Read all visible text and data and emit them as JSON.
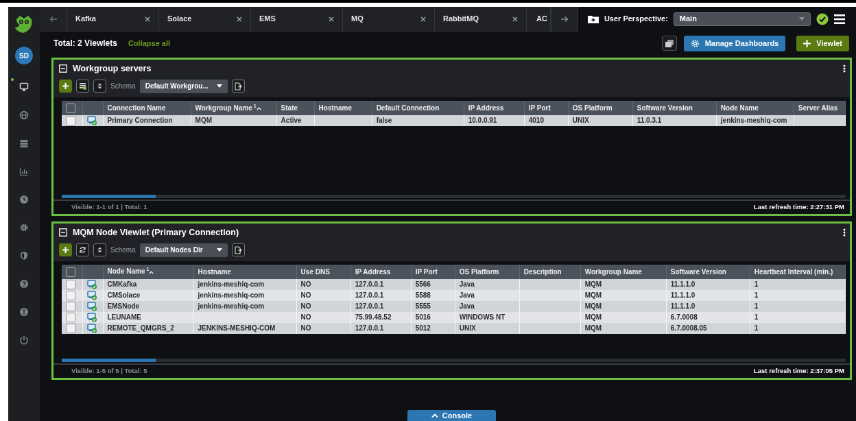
{
  "tabs": [
    {
      "label": "Kafka",
      "selected": false,
      "closable": true
    },
    {
      "label": "Solace",
      "selected": false,
      "closable": true
    },
    {
      "label": "EMS",
      "selected": false,
      "closable": true
    },
    {
      "label": "MQ",
      "selected": false,
      "closable": true
    },
    {
      "label": "RabbitMQ",
      "selected": false,
      "closable": true
    },
    {
      "label": "AC",
      "selected": false,
      "closable": false
    }
  ],
  "perspective": {
    "label": "User Perspective:",
    "value": "Main"
  },
  "sidebar": {
    "avatar": "SD",
    "items": [
      {
        "kind": "monitor",
        "selected": true
      },
      {
        "kind": "globe",
        "selected": false
      },
      {
        "kind": "server",
        "selected": false
      },
      {
        "kind": "chart",
        "selected": false
      },
      {
        "kind": "clock",
        "selected": false
      },
      {
        "kind": "gear",
        "selected": false
      },
      {
        "kind": "shield",
        "selected": false
      },
      {
        "kind": "help",
        "selected": false
      },
      {
        "kind": "info",
        "selected": false
      },
      {
        "kind": "power",
        "selected": false
      }
    ]
  },
  "header": {
    "total": "Total: 2 Viewlets",
    "collapse": "Collapse all",
    "buttons": [
      {
        "kind": "manage",
        "label": "Manage Dashboards"
      },
      {
        "kind": "add",
        "label": "Viewlet"
      }
    ]
  },
  "viewlets": [
    {
      "title": "Workgroup servers",
      "all_checked": false,
      "toolbar": [
        {
          "kind": "add"
        },
        {
          "kind": "table-add"
        },
        {
          "kind": "reorder"
        }
      ],
      "schema_label": "Schema",
      "schema": "Default Workgrou...",
      "columns": [
        {
          "label": "Connection Name"
        },
        {
          "label": "Workgroup Name",
          "sort": "1"
        },
        {
          "label": "State"
        },
        {
          "label": "Hostname"
        },
        {
          "label": "Default Connection"
        },
        {
          "label": "IP Address"
        },
        {
          "label": "IP Port"
        },
        {
          "label": "OS Platform"
        },
        {
          "label": "Software Version"
        },
        {
          "label": "Node Name"
        },
        {
          "label": "Server Alias"
        }
      ],
      "rows": [
        {
          "checked": false,
          "cells": [
            "Primary Connection",
            "MQM",
            "Active",
            "",
            "false",
            "10.0.0.91",
            "4010",
            "UNIX",
            "11.0.3.1",
            "jenkins-meshiq-com",
            ""
          ]
        }
      ],
      "visible": "Visible: 1-1 of 1 | Total: 1",
      "refresh": "Last refresh time: 2:27:31 PM"
    },
    {
      "title": "MQM Node Viewlet (Primary Connection)",
      "all_checked": false,
      "toolbar": [
        {
          "kind": "add"
        },
        {
          "kind": "refresh"
        },
        {
          "kind": "reorder"
        }
      ],
      "schema_label": "Schema",
      "schema": "Default Nodes Dir",
      "columns": [
        {
          "label": "Node Name",
          "sort": "1"
        },
        {
          "label": "Hostname"
        },
        {
          "label": "Use DNS"
        },
        {
          "label": "IP Address"
        },
        {
          "label": "IP Port"
        },
        {
          "label": "OS Platform"
        },
        {
          "label": "Description"
        },
        {
          "label": "Workgroup Name"
        },
        {
          "label": "Software Version"
        },
        {
          "label": "Heartbeat Interval (min.)"
        }
      ],
      "rows": [
        {
          "checked": false,
          "cells": [
            "CMKafka",
            "jenkins-meshiq-com",
            "NO",
            "127.0.0.1",
            "5566",
            "Java",
            "",
            "MQM",
            "11.1.1.0",
            "1"
          ]
        },
        {
          "checked": false,
          "cells": [
            "CMSolace",
            "jenkins-meshiq-com",
            "NO",
            "127.0.0.1",
            "5588",
            "Java",
            "",
            "MQM",
            "11.1.1.0",
            "1"
          ]
        },
        {
          "checked": false,
          "cells": [
            "EMSNode",
            "jenkins-meshiq-com",
            "NO",
            "127.0.0.1",
            "5555",
            "Java",
            "",
            "MQM",
            "11.1.1.0",
            "1"
          ]
        },
        {
          "checked": false,
          "cells": [
            "LEUNAME",
            "",
            "NO",
            "75.99.48.52",
            "5016",
            "WINDOWS NT",
            "",
            "MQM",
            "6.7.0008",
            "1"
          ]
        },
        {
          "checked": false,
          "cells": [
            "REMOTE_QMGRS_2",
            "JENKINS-MESHIQ-COM",
            "NO",
            "127.0.0.1",
            "5012",
            "UNIX",
            "",
            "MQM",
            "6.7.0008.05",
            "1"
          ]
        }
      ],
      "visible": "Visible: 1-5 of 5 | Total: 5",
      "refresh": "Last refresh time: 2:37:05 PM"
    }
  ],
  "console": "Console"
}
